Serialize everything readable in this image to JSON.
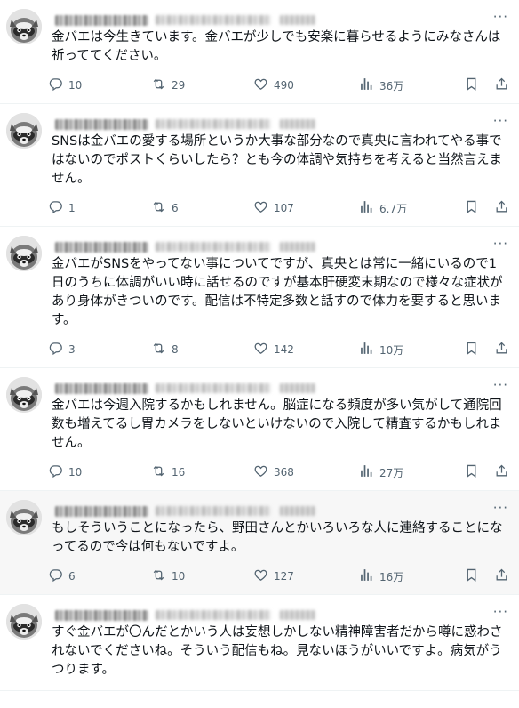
{
  "tweets": [
    {
      "text": "金バエは今生きています。金バエが少しでも安楽に暮らせるようにみなさんは祈っててください。",
      "replies": "10",
      "retweets": "29",
      "likes": "490",
      "views": "36万",
      "highlighted": false
    },
    {
      "text": "SNSは金バエの愛する場所というか大事な部分なので真央に言われてやる事ではないのでポストくらいしたら？とも今の体調や気持ちを考えると当然言えません。",
      "replies": "1",
      "retweets": "6",
      "likes": "107",
      "views": "6.7万",
      "highlighted": false
    },
    {
      "text": "金バエがSNSをやってない事についてですが、真央とは常に一緒にいるので1日のうちに体調がいい時に話せるのですが基本肝硬変末期なので様々な症状があり身体がきついのです。配信は不特定多数と話すので体力を要すると思います。",
      "replies": "3",
      "retweets": "8",
      "likes": "142",
      "views": "10万",
      "highlighted": false
    },
    {
      "text": "金バエは今週入院するかもしれません。脳症になる頻度が多い気がして通院回数も増えてるし胃カメラをしないといけないので入院して精査するかもしれません。",
      "replies": "10",
      "retweets": "16",
      "likes": "368",
      "views": "27万",
      "highlighted": false
    },
    {
      "text": "もしそういうことになったら、野田さんとかいろいろな人に連絡することになってるので今は何もないですよ。",
      "replies": "6",
      "retweets": "10",
      "likes": "127",
      "views": "16万",
      "highlighted": true
    },
    {
      "text": "すぐ金バエが〇んだとかいう人は妄想しかしない精神障害者だから噂に惑わされないでくださいね。そういう配信もね。見ないほうがいいですよ。病気がうつります。",
      "highlighted": false
    }
  ],
  "icons": {
    "reply": "reply-icon",
    "retweet": "retweet-icon",
    "like": "heart-icon",
    "views": "views-icon",
    "bookmark": "bookmark-icon",
    "share": "share-icon",
    "more": "more-icon"
  },
  "colors": {
    "secondary_text": "#536471",
    "divider": "#eff3f4",
    "highlight_bg": "#f7f7f7"
  }
}
